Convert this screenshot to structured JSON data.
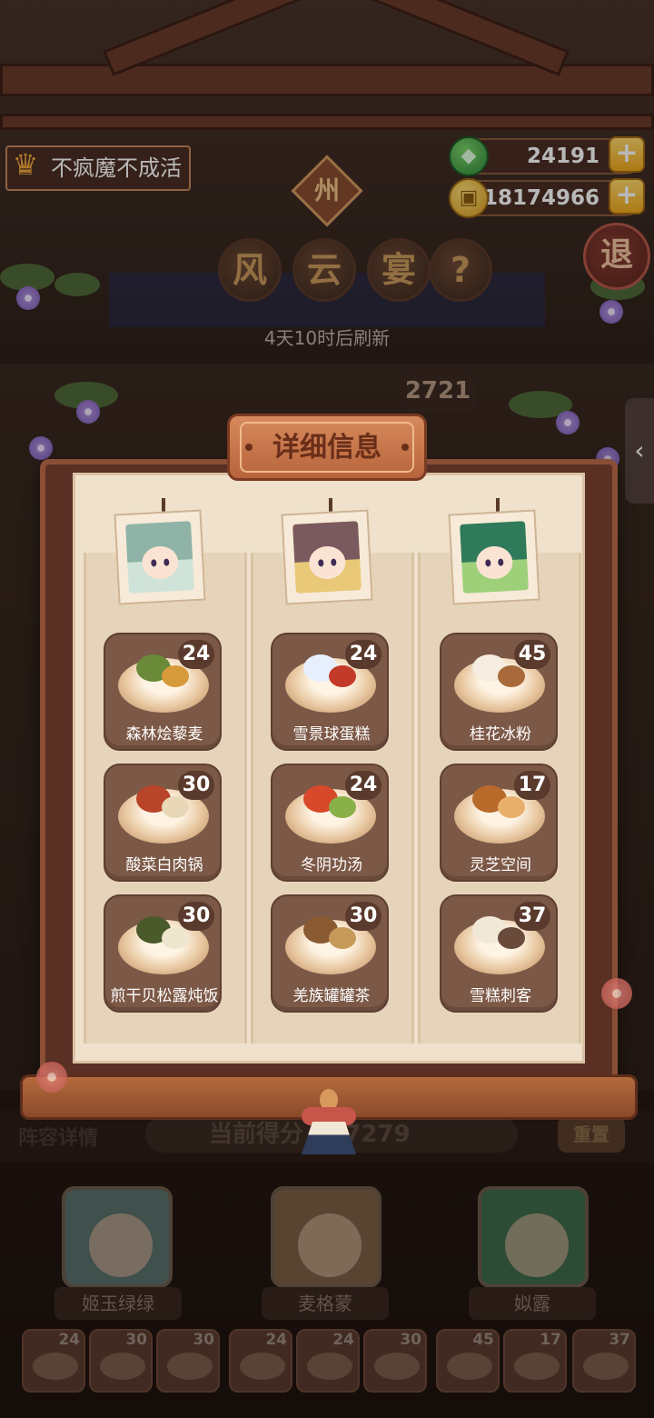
{
  "hud": {
    "player_name": "不疯魔不成活",
    "gems": "24191",
    "coins": "18174966",
    "plus": "+",
    "region_badge": "州"
  },
  "event": {
    "title_chars": [
      "风",
      "云",
      "宴",
      "?"
    ],
    "exit_label": "退",
    "refresh_text": "4天10时后刷新",
    "score_peek": "2721",
    "side_tab_icon": "‹"
  },
  "modal": {
    "title": "详细信息",
    "columns": [
      {
        "portrait_colors": {
          "hair": "#8fb3a6",
          "bg": "#cfe3d8"
        },
        "dishes": [
          {
            "name": "森林烩藜麦",
            "count": "24",
            "food1": "#6a8a3a",
            "food2": "#d69a3a"
          },
          {
            "name": "酸菜白肉锅",
            "count": "30",
            "food1": "#b8442a",
            "food2": "#e8d8b8"
          },
          {
            "name": "煎干贝松露炖饭",
            "count": "30",
            "food1": "#4a5a2a",
            "food2": "#efe6cf"
          }
        ]
      },
      {
        "portrait_colors": {
          "hair": "#7a5a5e",
          "bg": "#e9c878"
        },
        "dishes": [
          {
            "name": "雪景球蛋糕",
            "count": "24",
            "food1": "#e7efff",
            "food2": "#c43a2a"
          },
          {
            "name": "冬阴功汤",
            "count": "24",
            "food1": "#d8482a",
            "food2": "#8ab04a"
          },
          {
            "name": "羌族罐罐茶",
            "count": "30",
            "food1": "#8a5a32",
            "food2": "#c79a5a"
          }
        ]
      },
      {
        "portrait_colors": {
          "hair": "#2f7a5a",
          "bg": "#9ed07a"
        },
        "dishes": [
          {
            "name": "桂花冰粉",
            "count": "45",
            "food1": "#f6ece0",
            "food2": "#a86a3a"
          },
          {
            "name": "灵芝空间",
            "count": "17",
            "food1": "#b86a2a",
            "food2": "#e8b06a"
          },
          {
            "name": "雪糕刺客",
            "count": "37",
            "food1": "#f2e8d8",
            "food2": "#6a4a3a"
          }
        ]
      }
    ]
  },
  "lineup": {
    "label": "阵容详情",
    "score_text": "当前得分 417279",
    "reset_label": "重置",
    "characters": [
      {
        "name": "姬玉绿绿",
        "color": "#8fb3a6"
      },
      {
        "name": "麦格蒙",
        "color": "#7a5a5e"
      },
      {
        "name": "姒露",
        "color": "#2f7a5a"
      }
    ],
    "dishes": [
      {
        "count": "24"
      },
      {
        "count": "30"
      },
      {
        "count": "30"
      },
      {
        "count": "24"
      },
      {
        "count": "24"
      },
      {
        "count": "30"
      },
      {
        "count": "45"
      },
      {
        "count": "17"
      },
      {
        "count": "37"
      }
    ]
  },
  "colors": {
    "frame": "#5a2f24",
    "paper": "#efe1cb",
    "dish_card": "#7c5846",
    "accent_gold": "#f0a91e"
  }
}
